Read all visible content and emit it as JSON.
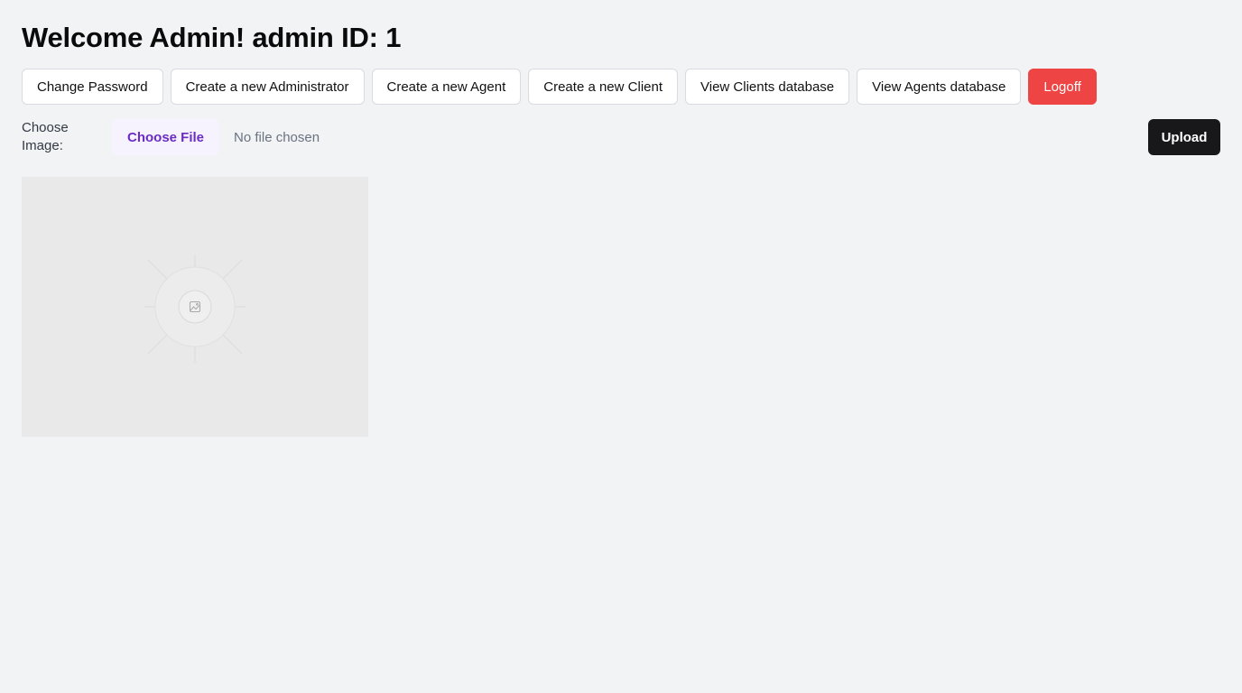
{
  "header": {
    "title": "Welcome Admin! admin ID: 1"
  },
  "nav": {
    "buttons": [
      {
        "label": "Change Password"
      },
      {
        "label": "Create a new Administrator"
      },
      {
        "label": "Create a new Agent"
      },
      {
        "label": "Create a new Client"
      },
      {
        "label": "View Clients database"
      },
      {
        "label": "View Agents database"
      },
      {
        "label": "Logoff"
      }
    ]
  },
  "upload": {
    "label": "Choose Image:",
    "choose_file_label": "Choose File",
    "file_status": "No file chosen",
    "upload_label": "Upload"
  },
  "image": {
    "icon": "image-placeholder-icon"
  },
  "colors": {
    "background": "#f2f3f5",
    "logoff": "#ef4444",
    "upload": "#18181b",
    "choose_file_text": "#6b2cc4"
  }
}
